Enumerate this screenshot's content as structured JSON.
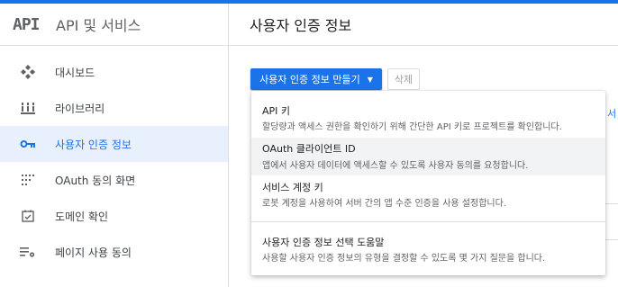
{
  "sidebar": {
    "logo": "API",
    "title": "API 및 서비스",
    "items": [
      {
        "label": "대시보드",
        "icon": "dashboard-icon"
      },
      {
        "label": "라이브러리",
        "icon": "library-icon"
      },
      {
        "label": "사용자 인증 정보",
        "icon": "key-icon",
        "active": true
      },
      {
        "label": "OAuth 동의 화면",
        "icon": "oauth-consent-icon"
      },
      {
        "label": "도메인 확인",
        "icon": "domain-check-icon"
      },
      {
        "label": "페이지 사용 동의",
        "icon": "page-usage-agreement-icon"
      }
    ]
  },
  "main": {
    "title": "사용자 인증 정보",
    "create_button": "사용자 인증 정보 만들기",
    "delete_button": "삭제",
    "partial_text": "서"
  },
  "dropdown": {
    "items": [
      {
        "title": "API 키",
        "desc": "할당량과 액세스 권한을 확인하기 위해 간단한 API 키로 프로젝트를 확인합니다."
      },
      {
        "title": "OAuth 클라이언트 ID",
        "desc": "앱에서 사용자 데이터에 액세스할 수 있도록 사용자 동의를 요청합니다."
      },
      {
        "title": "서비스 계정 키",
        "desc": "로봇 계정을 사용하여 서버 간의 앱 수준 인증을 사용 설정합니다."
      },
      {
        "title": "사용자 인증 정보 선택 도움말",
        "desc": "사용할 사용자 인증 정보의 유형을 결정할 수 있도록 몇 가지 질문을 합니다."
      }
    ]
  },
  "colors": {
    "accent": "#1a73e8",
    "active_bg": "#e8f0fe",
    "hover_bg": "#f1f3f4"
  }
}
